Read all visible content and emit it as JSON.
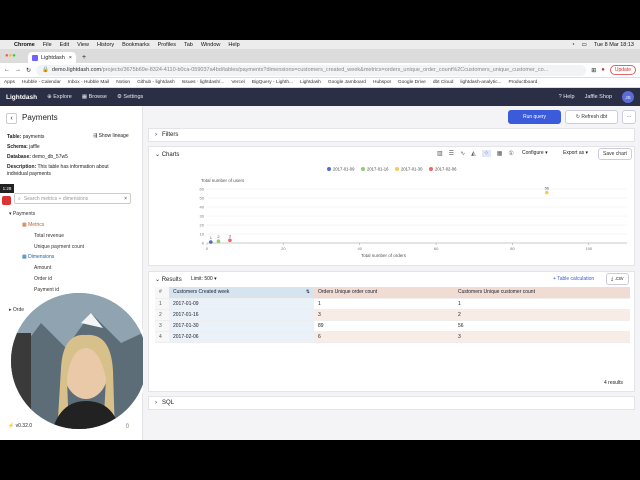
{
  "mac": {
    "apple": "",
    "app": "Chrome",
    "menus": [
      "File",
      "Edit",
      "View",
      "History",
      "Bookmarks",
      "Profiles",
      "Tab",
      "Window",
      "Help"
    ],
    "clock": "Tue 8 Mar 18:13"
  },
  "browser": {
    "tab_title": "Lightdash",
    "url_host": "demo.lightdash.com",
    "url_path": "/projects/3675b69e-8324-4110-b0ca-059037a4bd/tables/payments?dimensions=customers_created_week&metrics=orders_unique_order_count%2Ccustomers_unique_customer_co...",
    "update_label": "Update",
    "bookmarks": [
      "Apps",
      "Hubble - Calendar",
      "Inbox - Hubble Mail",
      "Notion",
      "Github - lightdash",
      "Issues · lightdash/...",
      "Vercel",
      "BigQuery - Lighth...",
      "Lightdash",
      "Google Jamboard",
      "Hubspot",
      "Google Drive",
      "dbt Cloud",
      "lightdash-analytic...",
      "Productboard"
    ]
  },
  "nav": {
    "logo": "Lightdash",
    "items": [
      "Explore",
      "Browse",
      "Settings"
    ],
    "help": "Help",
    "user": "Jaffle Shop"
  },
  "sidebar": {
    "back": "‹",
    "title": "Payments",
    "table_label": "Table:",
    "table_value": "payments",
    "show_lineage": "Show lineage",
    "schema_label": "Schema:",
    "schema_value": "jaffle",
    "database_label": "Database:",
    "database_value": "demo_db_57w5",
    "desc_label": "Description:",
    "desc_value": "This table has information about individual payments",
    "search_placeholder": "Search metrics + dimensions",
    "tree": {
      "group": "Payments",
      "metrics": "Metrics",
      "metric_items": [
        "Total revenue",
        "Unique payment count"
      ],
      "dimensions": "Dimensions",
      "dimension_items": [
        "Amount",
        "Order id",
        "Payment id"
      ],
      "orders": "Orde"
    },
    "version": "v0.32.0",
    "timer": "1:28"
  },
  "toolbar": {
    "run": "Run query",
    "refresh": "Refresh dbt",
    "more": "···"
  },
  "filters": {
    "label": "Filters"
  },
  "charts": {
    "label": "Charts",
    "configure": "Configure",
    "export": "Export as",
    "save": "Save chart"
  },
  "chart_data": {
    "type": "scatter",
    "title": "",
    "ylabel": "Total number of users",
    "xlabel": "Total number of orders",
    "xlim": [
      0,
      110
    ],
    "ylim": [
      0,
      60
    ],
    "xticks": [
      0,
      20,
      40,
      60,
      80,
      100
    ],
    "yticks": [
      0,
      10,
      20,
      30,
      40,
      50,
      60
    ],
    "series": [
      {
        "name": "2017-01-09",
        "x": [
          1
        ],
        "y": [
          1
        ],
        "label": "1",
        "color": "#5470c6"
      },
      {
        "name": "2017-01-16",
        "x": [
          3
        ],
        "y": [
          2
        ],
        "label": "2",
        "color": "#91cc75"
      },
      {
        "name": "2017-01-30",
        "x": [
          89
        ],
        "y": [
          56
        ],
        "label": "56",
        "color": "#fac858"
      },
      {
        "name": "2017-02-06",
        "x": [
          6
        ],
        "y": [
          3
        ],
        "label": "3",
        "color": "#ee6666"
      }
    ]
  },
  "results": {
    "label": "Results",
    "limit": "Limit: 500",
    "add_calc": "+ Table calculation",
    "csv": ".csv",
    "columns": [
      "#",
      "Customers Created week",
      "Orders Unique order count",
      "Customers Unique customer count"
    ],
    "rows": [
      [
        "1",
        "2017-01-09",
        "1",
        "1"
      ],
      [
        "2",
        "2017-01-16",
        "3",
        "2"
      ],
      [
        "3",
        "2017-01-30",
        "89",
        "56"
      ],
      [
        "4",
        "2017-02-06",
        "6",
        "3"
      ]
    ],
    "count": "4 results"
  },
  "sql": {
    "label": "SQL"
  }
}
